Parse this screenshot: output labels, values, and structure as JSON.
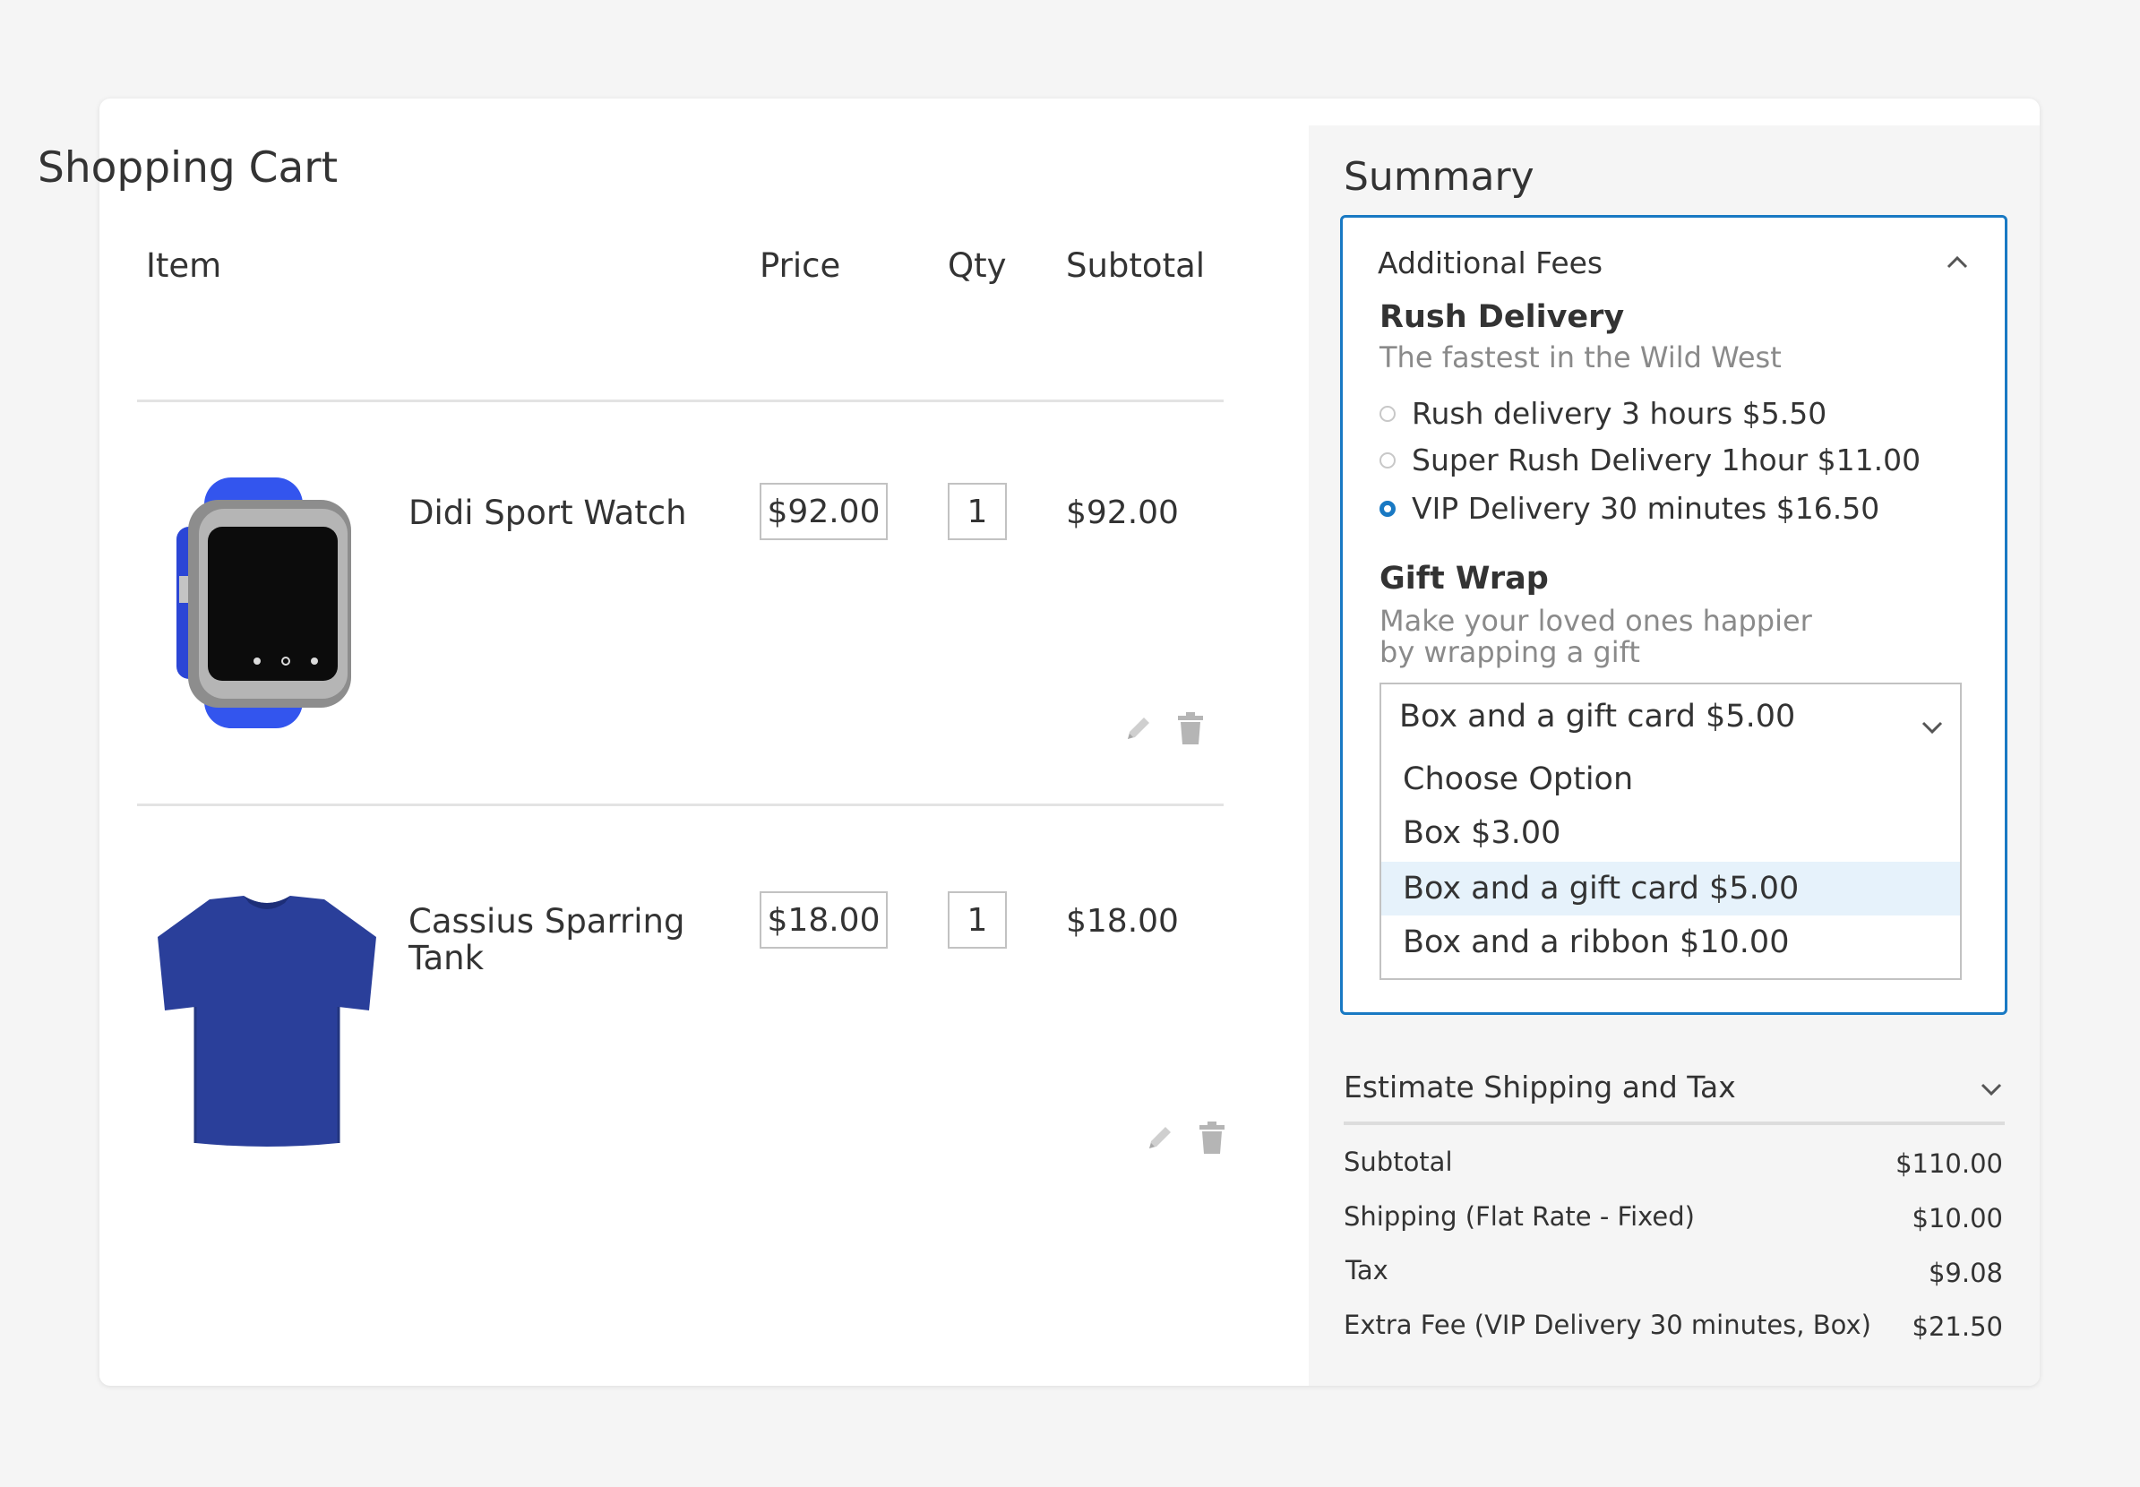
{
  "cart": {
    "title": "Shopping Cart",
    "columns": {
      "item": "Item",
      "price": "Price",
      "qty": "Qty",
      "subtotal": "Subtotal"
    },
    "items": [
      {
        "name": "Didi Sport Watch",
        "price": "$92.00",
        "qty": "1",
        "subtotal": "$92.00",
        "image_icon": "smartwatch-icon"
      },
      {
        "name": "Cassius Sparring Tank",
        "price": "$18.00",
        "qty": "1",
        "subtotal": "$18.00",
        "image_icon": "tshirt-icon"
      }
    ]
  },
  "summary": {
    "title": "Summary",
    "additional_fees": {
      "header": "Additional Fees",
      "rush": {
        "title": "Rush Delivery",
        "subtitle": "The fastest in the Wild West",
        "options": [
          {
            "label": "Rush delivery 3 hours $5.50",
            "checked": false
          },
          {
            "label": "Super Rush Delivery 1hour $11.00",
            "checked": false
          },
          {
            "label": "VIP Delivery 30 minutes $16.50",
            "checked": true
          }
        ]
      },
      "gift_wrap": {
        "title": "Gift Wrap",
        "subtitle": "Make your loved ones happier by wrapping a gift",
        "selected": "Box and a gift card $5.00",
        "options": [
          "Choose Option",
          "Box $3.00",
          "Box and a gift card $5.00",
          "Box and a ribbon $10.00"
        ]
      }
    },
    "estimate_shipping_label": "Estimate Shipping and Tax",
    "totals": [
      {
        "label": "Subtotal",
        "value": "$110.00"
      },
      {
        "label": "Shipping (Flat Rate - Fixed)",
        "value": "$10.00"
      },
      {
        "label": "Tax",
        "value": "$9.08"
      },
      {
        "label": "Extra Fee (VIP Delivery 30 minutes, Box)",
        "value": "$21.50"
      }
    ]
  },
  "colors": {
    "accent": "#1979c3",
    "watch_band": "#3355ee",
    "tshirt": "#2a3f9a"
  }
}
